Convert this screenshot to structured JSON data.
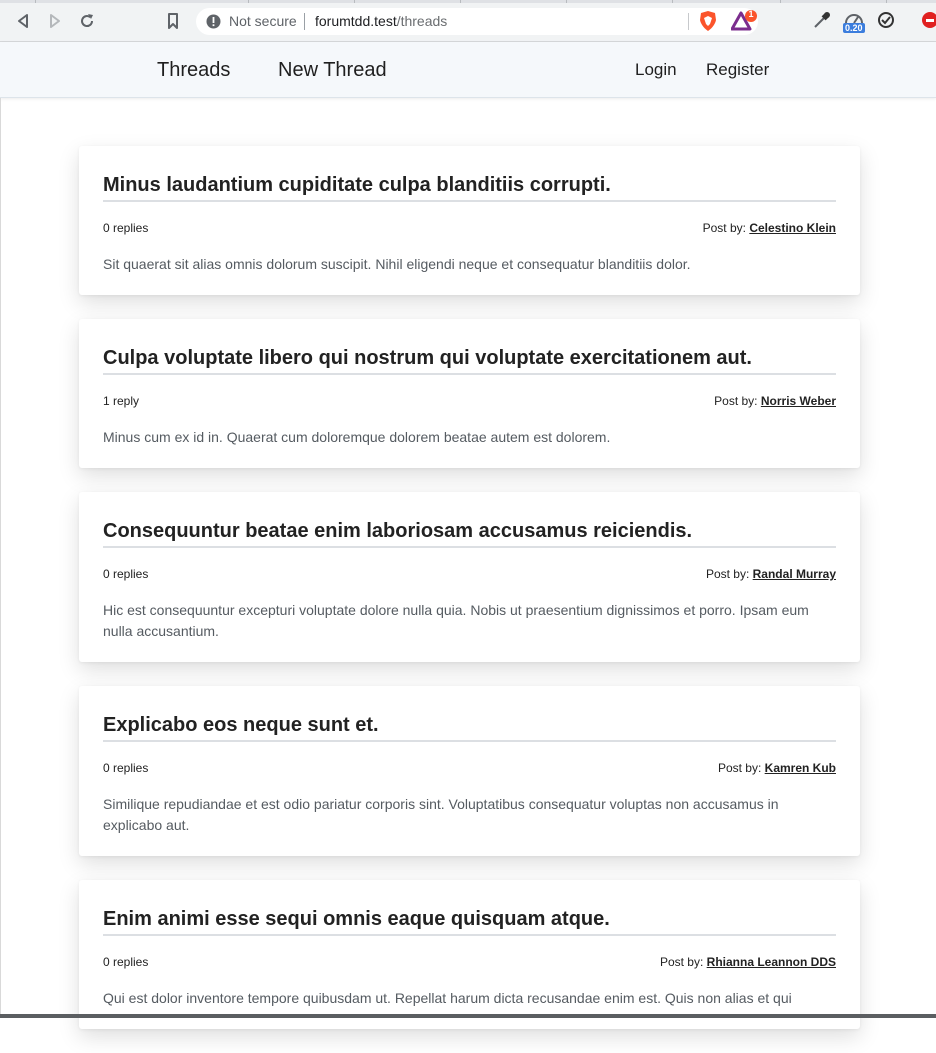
{
  "browser": {
    "security_label": "Not secure",
    "url_host": "forumtdd.test",
    "url_path": "/threads",
    "notification_badge": "1",
    "extension_badge": "0.20"
  },
  "nav": {
    "threads": "Threads",
    "new_thread": "New Thread",
    "login": "Login",
    "register": "Register"
  },
  "threads": [
    {
      "title": "Minus laudantium cupiditate culpa blanditiis corrupti.",
      "replies": "0 replies",
      "posted_by_label": "Post by:",
      "author": "Celestino Klein",
      "body": "Sit quaerat sit alias omnis dolorum suscipit. Nihil eligendi neque et consequatur blanditiis dolor."
    },
    {
      "title": "Culpa voluptate libero qui nostrum qui voluptate exercitationem aut.",
      "replies": "1 reply",
      "posted_by_label": "Post by:",
      "author": "Norris Weber",
      "body": "Minus cum ex id in. Quaerat cum doloremque dolorem beatae autem est dolorem."
    },
    {
      "title": "Consequuntur beatae enim laboriosam accusamus reiciendis.",
      "replies": "0 replies",
      "posted_by_label": "Post by:",
      "author": "Randal Murray",
      "body": "Hic est consequuntur excepturi voluptate dolore nulla quia. Nobis ut praesentium dignissimos et porro. Ipsam eum nulla accusantium."
    },
    {
      "title": "Explicabo eos neque sunt et.",
      "replies": "0 replies",
      "posted_by_label": "Post by:",
      "author": "Kamren Kub",
      "body": "Similique repudiandae et est odio pariatur corporis sint. Voluptatibus consequatur voluptas non accusamus in explicabo aut."
    },
    {
      "title": "Enim animi esse sequi omnis eaque quisquam atque.",
      "replies": "0 replies",
      "posted_by_label": "Post by:",
      "author": "Rhianna Leannon DDS",
      "body": "Qui est dolor inventore tempore quibusdam ut. Repellat harum dicta recusandae enim est. Quis non alias et qui"
    }
  ]
}
